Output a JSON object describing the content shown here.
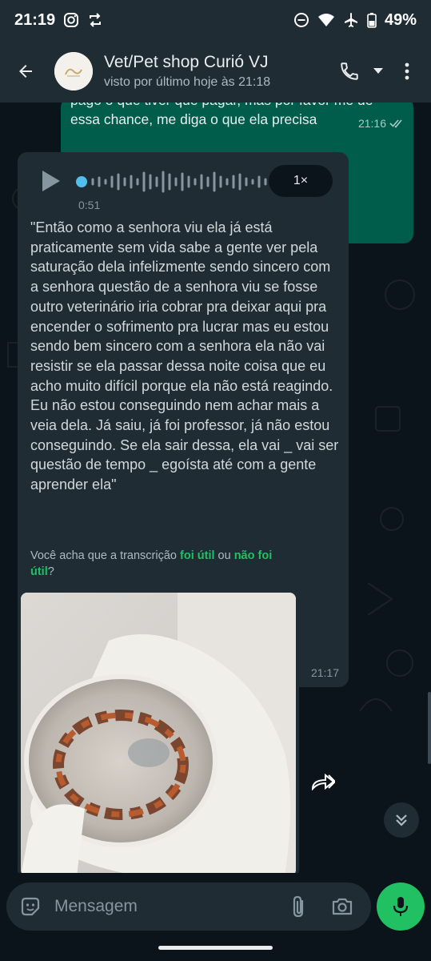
{
  "status_bar": {
    "time": "21:19",
    "battery": "49%",
    "icons": [
      "instagram-icon",
      "sync-icon",
      "do-not-disturb-icon",
      "wifi-icon",
      "airplane-icon",
      "battery-icon"
    ]
  },
  "header": {
    "contact_name": "Vet/Pet shop Curió VJ",
    "last_seen": "visto por último hoje às 21:18",
    "icons": [
      "back-arrow-icon",
      "phone-icon",
      "dropdown-icon",
      "more-vert-icon"
    ]
  },
  "messages": {
    "outgoing": {
      "text_line1": "pago o que tiver que pagar, mas por favor me dê",
      "text_line2": "essa chance, me diga o que ela precisa",
      "time": "21:16"
    },
    "voice": {
      "duration": "0:51",
      "speed": "1×",
      "transcript": "\"Então como a senhora viu ela já está praticamente sem vida sabe a gente ver pela saturação dela infelizmente sendo sincero com a senhora questão de a senhora viu se fosse outro veterinário iria cobrar pra deixar aqui pra encender o sofrimento pra lucrar mas eu estou sendo bem sincero com a senhora ela não vai resistir se ela passar dessa noite coisa que eu acho muito difícil porque ela não está reagindo. Eu não estou conseguindo nem achar mais a veia dela. Já saiu, já foi professor, já não estou conseguindo. Se ela sair dessa, ela vai _ vai ser questão de tempo _ egoísta até com a gente aprender ela\"",
      "feedback_prefix": "Você acha que a transcrição ",
      "feedback_useful": "foi útil",
      "feedback_or": " ou ",
      "feedback_not_useful": "não foi útil",
      "feedback_suffix": "?",
      "time": "21:17"
    }
  },
  "composer": {
    "placeholder": "Mensagem"
  },
  "colors": {
    "background": "#0b141a",
    "bar": "#1f2c34",
    "outgoing_bubble": "#005c4b",
    "accent": "#21c063"
  }
}
